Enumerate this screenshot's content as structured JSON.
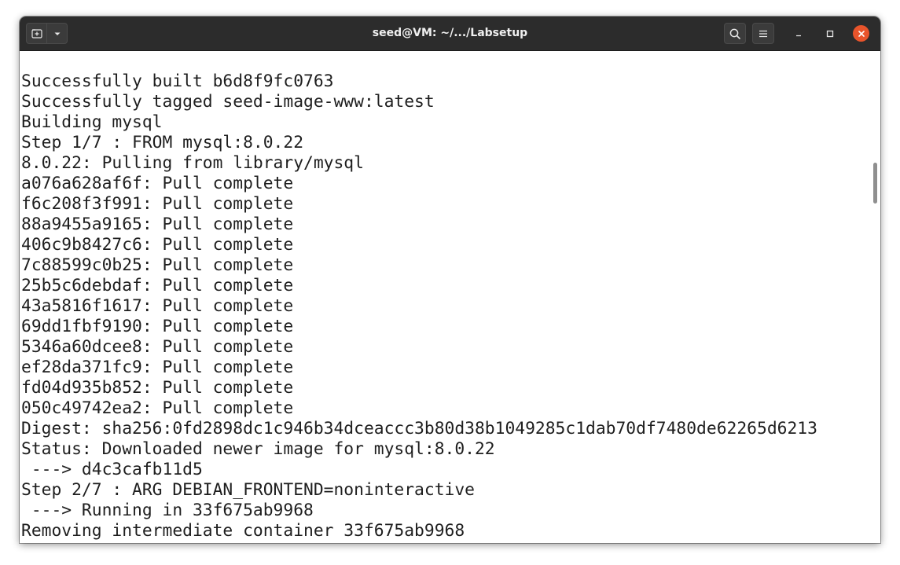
{
  "window": {
    "title": "seed@VM: ~/.../Labsetup"
  },
  "toolbar": {
    "new_tab_icon": "new-tab-icon",
    "menu_dropdown_icon": "chevron-down-icon",
    "search_icon": "search-icon",
    "hamburger_icon": "hamburger-menu-icon"
  },
  "controls": {
    "minimize_icon": "minimize-icon",
    "maximize_icon": "maximize-icon",
    "close_icon": "close-icon",
    "close_color": "#e9542b"
  },
  "terminal": {
    "background": "#ffffff",
    "foreground": "#1e1e1e",
    "lines": [
      "Successfully built b6d8f9fc0763",
      "Successfully tagged seed-image-www:latest",
      "Building mysql",
      "Step 1/7 : FROM mysql:8.0.22",
      "8.0.22: Pulling from library/mysql",
      "a076a628af6f: Pull complete",
      "f6c208f3f991: Pull complete",
      "88a9455a9165: Pull complete",
      "406c9b8427c6: Pull complete",
      "7c88599c0b25: Pull complete",
      "25b5c6debdaf: Pull complete",
      "43a5816f1617: Pull complete",
      "69dd1fbf9190: Pull complete",
      "5346a60dcee8: Pull complete",
      "ef28da371fc9: Pull complete",
      "fd04d935b852: Pull complete",
      "050c49742ea2: Pull complete",
      "Digest: sha256:0fd2898dc1c946b34dceaccc3b80d38b1049285c1dab70df7480de62265d6213",
      "Status: Downloaded newer image for mysql:8.0.22",
      " ---> d4c3cafb11d5",
      "Step 2/7 : ARG DEBIAN_FRONTEND=noninteractive",
      " ---> Running in 33f675ab9968",
      "Removing intermediate container 33f675ab9968"
    ]
  }
}
